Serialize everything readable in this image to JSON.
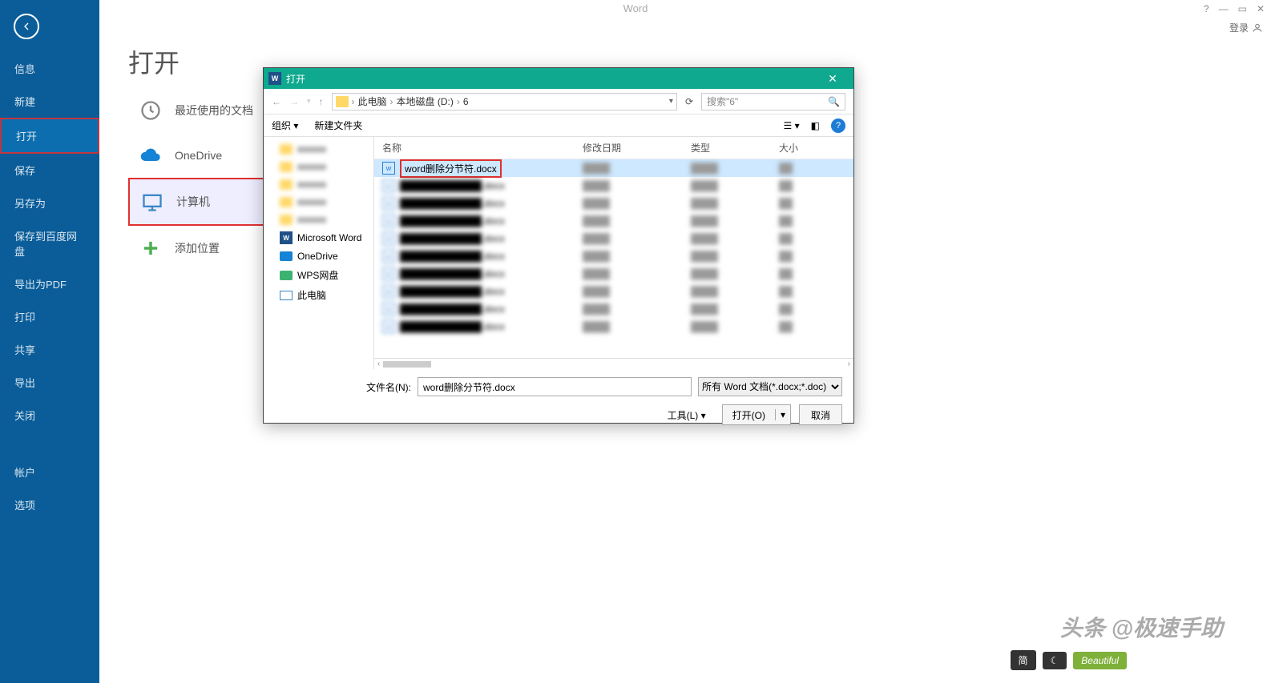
{
  "app": {
    "title": "Word",
    "login": "登录"
  },
  "window_controls": {
    "help": "?",
    "minimize": "—",
    "maximize": "▭",
    "close": "✕"
  },
  "page": {
    "title": "打开"
  },
  "sidebar": {
    "items": [
      {
        "label": "信息",
        "active": false
      },
      {
        "label": "新建",
        "active": false
      },
      {
        "label": "打开",
        "active": true,
        "highlighted": true
      },
      {
        "label": "保存",
        "active": false
      },
      {
        "label": "另存为",
        "active": false
      },
      {
        "label": "保存到百度网盘",
        "active": false
      },
      {
        "label": "导出为PDF",
        "active": false
      },
      {
        "label": "打印",
        "active": false
      },
      {
        "label": "共享",
        "active": false
      },
      {
        "label": "导出",
        "active": false
      },
      {
        "label": "关闭",
        "active": false
      }
    ],
    "footer": [
      {
        "label": "帐户"
      },
      {
        "label": "选项"
      }
    ]
  },
  "locations": [
    {
      "icon": "clock",
      "label": "最近使用的文档"
    },
    {
      "icon": "cloud",
      "label": "OneDrive"
    },
    {
      "icon": "computer",
      "label": "计算机",
      "highlighted": true
    },
    {
      "icon": "plus",
      "label": "添加位置"
    }
  ],
  "dialog": {
    "title": "打开",
    "breadcrumb": [
      "此电脑",
      "本地磁盘 (D:)",
      "6"
    ],
    "search_placeholder": "搜索\"6\"",
    "toolbar": {
      "organize": "组织",
      "new_folder": "新建文件夹"
    },
    "tree": [
      {
        "type": "folder",
        "label": "",
        "blurred": true
      },
      {
        "type": "folder",
        "label": "",
        "blurred": true
      },
      {
        "type": "folder",
        "label": "",
        "blurred": true
      },
      {
        "type": "folder",
        "label": "",
        "blurred": true
      },
      {
        "type": "folder",
        "label": "",
        "blurred": true
      },
      {
        "type": "word",
        "label": "Microsoft Word"
      },
      {
        "type": "onedrive",
        "label": "OneDrive"
      },
      {
        "type": "wps",
        "label": "WPS网盘"
      },
      {
        "type": "pc",
        "label": "此电脑"
      }
    ],
    "columns": {
      "name": "名称",
      "date": "修改日期",
      "type": "类型",
      "size": "大小"
    },
    "rows": [
      {
        "name": "word删除分节符.docx",
        "selected": true,
        "highlighted": true
      },
      {
        "blurred": true
      },
      {
        "blurred": true
      },
      {
        "blurred": true
      },
      {
        "blurred": true
      },
      {
        "blurred": true
      },
      {
        "blurred": true
      },
      {
        "blurred": true
      },
      {
        "blurred": true
      },
      {
        "blurred": true
      }
    ],
    "filename_label": "文件名(N):",
    "filename_value": "word删除分节符.docx",
    "filter": "所有 Word 文档(*.docx;*.doc)",
    "tools_label": "工具(L)",
    "open_btn": "打开(O)",
    "cancel_btn": "取消"
  },
  "watermark": "头条 @极速手助",
  "bottom": {
    "jian": "简",
    "moon": "☾",
    "beau": "Beautiful"
  }
}
